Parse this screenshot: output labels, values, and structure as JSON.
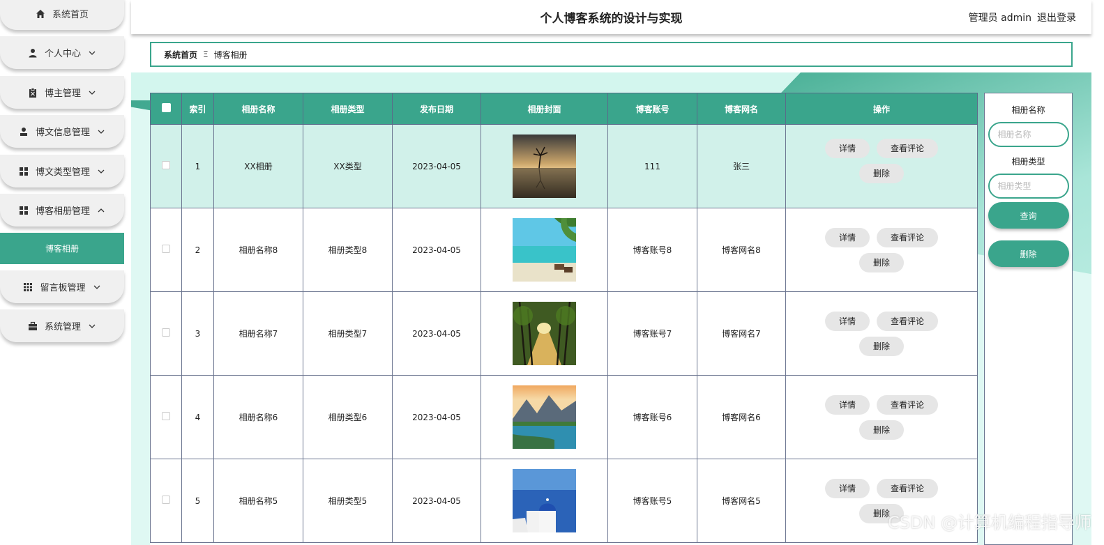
{
  "app": {
    "title": "个人博客系统的设计与实现",
    "user_label": "管理员 admin",
    "logout": "退出登录"
  },
  "sidebar": {
    "items": [
      {
        "label": "系统首页",
        "icon": "home-icon"
      },
      {
        "label": "个人中心",
        "icon": "user-icon"
      },
      {
        "label": "博主管理",
        "icon": "clipboard-icon"
      },
      {
        "label": "博文信息管理",
        "icon": "person-icon"
      },
      {
        "label": "博文类型管理",
        "icon": "grid-icon"
      },
      {
        "label": "博客相册管理",
        "icon": "grid-icon"
      },
      {
        "label": "留言板管理",
        "icon": "grid-small-icon"
      },
      {
        "label": "系统管理",
        "icon": "briefcase-icon"
      }
    ],
    "active_sub": "博客相册"
  },
  "breadcrumb": {
    "home": "系统首页",
    "separator": "Ξ",
    "current": "博客相册"
  },
  "table": {
    "headers": [
      "索引",
      "相册名称",
      "相册类型",
      "发布日期",
      "相册封面",
      "博客账号",
      "博客网名",
      "操作"
    ],
    "rows": [
      {
        "index": "1",
        "name": "XX相册",
        "type": "XX类型",
        "date": "2023-04-05",
        "cover": "tree-lake-sunset",
        "account": "111",
        "nickname": "张三"
      },
      {
        "index": "2",
        "name": "相册名称8",
        "type": "相册类型8",
        "date": "2023-04-05",
        "cover": "beach-palm",
        "account": "博客账号8",
        "nickname": "博客网名8"
      },
      {
        "index": "3",
        "name": "相册名称7",
        "type": "相册类型7",
        "date": "2023-04-05",
        "cover": "tree-avenue",
        "account": "博客账号7",
        "nickname": "博客网名7"
      },
      {
        "index": "4",
        "name": "相册名称6",
        "type": "相册类型6",
        "date": "2023-04-05",
        "cover": "mountain-lake",
        "account": "博客账号6",
        "nickname": "博客网名6"
      },
      {
        "index": "5",
        "name": "相册名称5",
        "type": "相册类型5",
        "date": "2023-04-05",
        "cover": "santorini",
        "account": "博客账号5",
        "nickname": "博客网名5"
      }
    ],
    "actions": {
      "detail": "详情",
      "comments": "查看评论",
      "delete": "删除"
    }
  },
  "search": {
    "name_label": "相册名称",
    "name_placeholder": "相册名称",
    "type_label": "相册类型",
    "type_placeholder": "相册类型",
    "query_button": "查询",
    "delete_button": "删除"
  },
  "watermark": "CSDN @计算机编程指导师",
  "colors": {
    "accent": "#3aa58c",
    "row_highlight": "#d1f1ea"
  }
}
